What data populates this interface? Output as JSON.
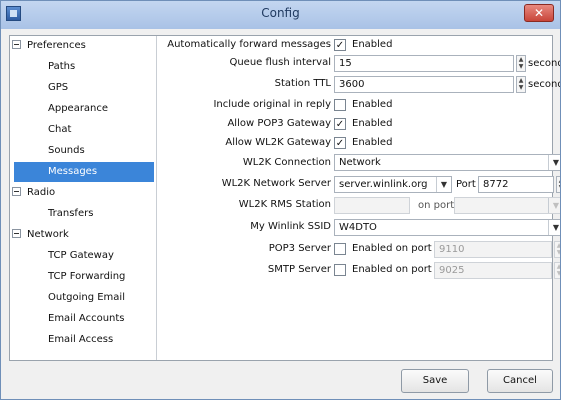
{
  "window": {
    "title": "Config"
  },
  "sidebar": {
    "preferences": {
      "label": "Preferences",
      "items": [
        "Paths",
        "GPS",
        "Appearance",
        "Chat",
        "Sounds",
        "Messages"
      ]
    },
    "radio": {
      "label": "Radio",
      "items": [
        "Transfers"
      ]
    },
    "network": {
      "label": "Network",
      "items": [
        "TCP Gateway",
        "TCP Forwarding",
        "Outgoing Email",
        "Email Accounts",
        "Email Access"
      ]
    },
    "selected": "Messages"
  },
  "settings": {
    "auto_forward": {
      "label": "Automatically forward messages",
      "checked": true,
      "text": "Enabled"
    },
    "queue_flush": {
      "label": "Queue flush interval",
      "value": "15",
      "unit": "seconds"
    },
    "station_ttl": {
      "label": "Station TTL",
      "value": "3600",
      "unit": "seconds"
    },
    "include_original": {
      "label": "Include original in reply",
      "checked": false,
      "text": "Enabled"
    },
    "allow_pop3": {
      "label": "Allow POP3 Gateway",
      "checked": true,
      "text": "Enabled"
    },
    "allow_wl2k": {
      "label": "Allow WL2K Gateway",
      "checked": true,
      "text": "Enabled"
    },
    "wl2k_connection": {
      "label": "WL2K Connection",
      "value": "Network"
    },
    "wl2k_server": {
      "label": "WL2K Network Server",
      "value": "server.winlink.org",
      "port_label": "Port",
      "port": "8772"
    },
    "wl2k_rms": {
      "label": "WL2K RMS Station",
      "value": "",
      "port_label": "on port",
      "port": ""
    },
    "winlink_ssid": {
      "label": "My Winlink SSID",
      "value": "W4DTO"
    },
    "pop3_server": {
      "label": "POP3 Server",
      "checked": false,
      "text": "Enabled on port",
      "port": "9110"
    },
    "smtp_server": {
      "label": "SMTP Server",
      "checked": false,
      "text": "Enabled on port",
      "port": "9025"
    }
  },
  "buttons": {
    "save": "Save",
    "cancel": "Cancel"
  }
}
